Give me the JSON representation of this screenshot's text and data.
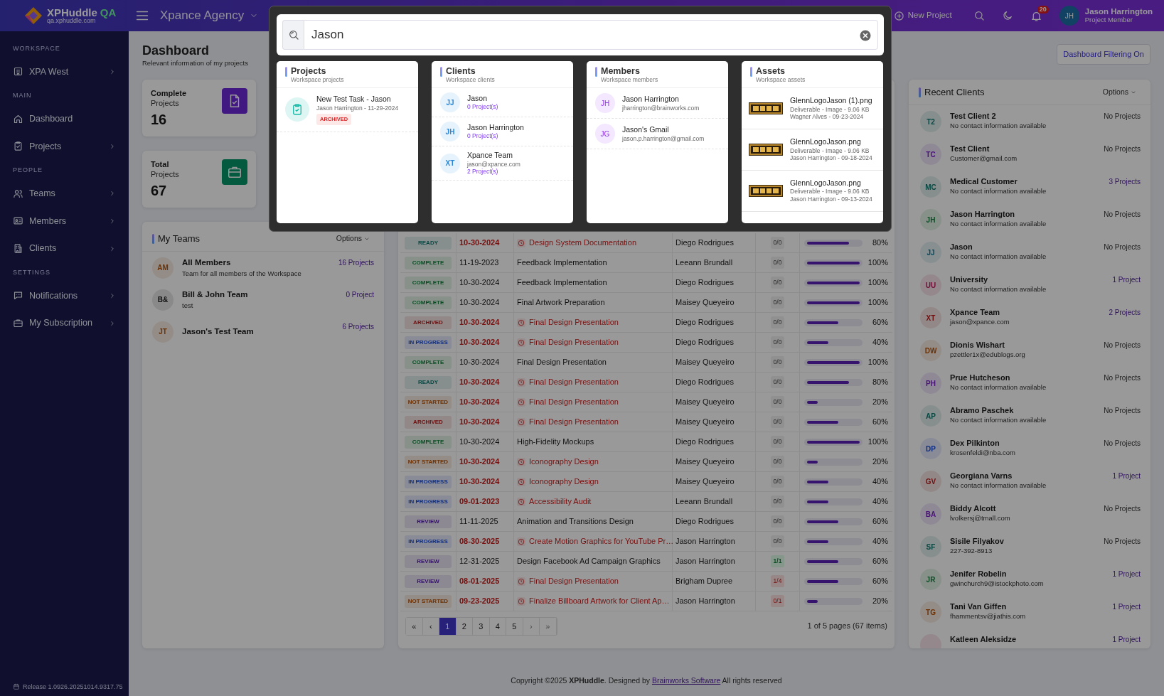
{
  "topbar": {
    "brand": "XPHuddle",
    "brand_tag": "QA",
    "brand_url": "qa.xphuddle.com",
    "workspace": "Xpance Agency",
    "new_project": "New Project",
    "notifications_count": "20",
    "user": {
      "initials": "JH",
      "name": "Jason Harrington",
      "role": "Project Member"
    }
  },
  "sidebar": {
    "sections": [
      {
        "title": "WORKSPACE",
        "items": [
          {
            "label": "XPA West",
            "has_submenu": true
          }
        ]
      },
      {
        "title": "MAIN",
        "items": [
          {
            "label": "Dashboard",
            "has_submenu": false
          },
          {
            "label": "Projects",
            "has_submenu": true
          }
        ]
      },
      {
        "title": "PEOPLE",
        "items": [
          {
            "label": "Teams",
            "has_submenu": true
          },
          {
            "label": "Members",
            "has_submenu": true
          },
          {
            "label": "Clients",
            "has_submenu": true
          }
        ]
      },
      {
        "title": "SETTINGS",
        "items": [
          {
            "label": "Notifications",
            "has_submenu": true
          },
          {
            "label": "My Subscription",
            "has_submenu": true
          }
        ]
      }
    ],
    "release": "Release 1.0926.20251014.9317.75"
  },
  "page": {
    "title": "Dashboard",
    "subtitle": "Relevant information of my projects",
    "filter_button": "Dashboard Filtering On"
  },
  "stats": [
    {
      "kind": "complete",
      "label": "Complete",
      "sublabel": "Projects",
      "value": "16"
    },
    {
      "kind": "total",
      "label": "Total",
      "sublabel": "Projects",
      "value": "67"
    }
  ],
  "my_teams": {
    "title": "My Teams",
    "options": "Options",
    "teams": [
      {
        "initials": "AM",
        "kind": "amber",
        "name": "All Members",
        "description": "Team for all members of the Workspace",
        "projects": "16 Projects"
      },
      {
        "initials": "B&",
        "kind": "neutral",
        "name": "Bill & John Team",
        "description": "test",
        "projects": "0 Project"
      },
      {
        "initials": "JT",
        "kind": "amber",
        "name": "Jason's Test Team",
        "projects": "6 Projects"
      }
    ]
  },
  "projects_table": {
    "rows": [
      {
        "status": "READY",
        "kind": "ready",
        "date": "10-30-2024",
        "overdue": true,
        "title": "Design System Documentation",
        "assignee": "Diego Rodrigues",
        "count": "0/0",
        "count_done": false,
        "count_behind": false,
        "level": 0.8,
        "percent": "80%"
      },
      {
        "status": "COMPLETE",
        "kind": "complete",
        "date": "11-19-2023",
        "overdue": false,
        "title": "Feedback Implementation",
        "assignee": "Leeann Brundall",
        "count": "0/0",
        "count_done": false,
        "count_behind": false,
        "level": 1,
        "percent": "100%"
      },
      {
        "status": "COMPLETE",
        "kind": "complete",
        "date": "10-30-2024",
        "overdue": false,
        "title": "Feedback Implementation",
        "assignee": "Diego Rodrigues",
        "count": "0/0",
        "count_done": false,
        "count_behind": false,
        "level": 1,
        "percent": "100%"
      },
      {
        "status": "COMPLETE",
        "kind": "complete",
        "date": "10-30-2024",
        "overdue": false,
        "title": "Final Artwork Preparation",
        "assignee": "Maisey Queyeiro",
        "count": "0/0",
        "count_done": false,
        "count_behind": false,
        "level": 1,
        "percent": "100%"
      },
      {
        "status": "ARCHIVED",
        "kind": "archived",
        "date": "10-30-2024",
        "overdue": true,
        "title": "Final Design Presentation",
        "assignee": "Diego Rodrigues",
        "count": "0/0",
        "count_done": false,
        "count_behind": false,
        "level": 0.6,
        "percent": "60%"
      },
      {
        "status": "IN PROGRESS",
        "kind": "progress",
        "date": "10-30-2024",
        "overdue": true,
        "title": "Final Design Presentation",
        "assignee": "Diego Rodrigues",
        "count": "0/0",
        "count_done": false,
        "count_behind": false,
        "level": 0.4,
        "percent": "40%"
      },
      {
        "status": "COMPLETE",
        "kind": "complete",
        "date": "10-30-2024",
        "overdue": false,
        "title": "Final Design Presentation",
        "assignee": "Maisey Queyeiro",
        "count": "0/0",
        "count_done": false,
        "count_behind": false,
        "level": 1,
        "percent": "100%"
      },
      {
        "status": "READY",
        "kind": "ready",
        "date": "10-30-2024",
        "overdue": true,
        "title": "Final Design Presentation",
        "assignee": "Diego Rodrigues",
        "count": "0/0",
        "count_done": false,
        "count_behind": false,
        "level": 0.8,
        "percent": "80%"
      },
      {
        "status": "NOT STARTED",
        "kind": "notstarted",
        "date": "10-30-2024",
        "overdue": true,
        "title": "Final Design Presentation",
        "assignee": "Maisey Queyeiro",
        "count": "0/0",
        "count_done": false,
        "count_behind": false,
        "level": 0.2,
        "percent": "20%"
      },
      {
        "status": "ARCHIVED",
        "kind": "archived",
        "date": "10-30-2024",
        "overdue": true,
        "title": "Final Design Presentation",
        "assignee": "Maisey Queyeiro",
        "count": "0/0",
        "count_done": false,
        "count_behind": false,
        "level": 0.6,
        "percent": "60%"
      },
      {
        "status": "COMPLETE",
        "kind": "complete",
        "date": "10-30-2024",
        "overdue": false,
        "title": "High-Fidelity Mockups",
        "assignee": "Diego Rodrigues",
        "count": "0/0",
        "count_done": false,
        "count_behind": false,
        "level": 1,
        "percent": "100%"
      },
      {
        "status": "NOT STARTED",
        "kind": "notstarted",
        "date": "10-30-2024",
        "overdue": true,
        "title": "Iconography Design",
        "assignee": "Maisey Queyeiro",
        "count": "0/0",
        "count_done": false,
        "count_behind": false,
        "level": 0.2,
        "percent": "20%"
      },
      {
        "status": "IN PROGRESS",
        "kind": "progress",
        "date": "10-30-2024",
        "overdue": true,
        "title": "Iconography Design",
        "assignee": "Maisey Queyeiro",
        "count": "0/0",
        "count_done": false,
        "count_behind": false,
        "level": 0.4,
        "percent": "40%"
      },
      {
        "status": "IN PROGRESS",
        "kind": "progress",
        "date": "09-01-2023",
        "overdue": true,
        "title": "Accessibility Audit",
        "assignee": "Leeann Brundall",
        "count": "0/0",
        "count_done": false,
        "count_behind": false,
        "level": 0.4,
        "percent": "40%"
      },
      {
        "status": "REVIEW",
        "kind": "review",
        "date": "11-11-2025",
        "overdue": false,
        "title": "Animation and Transitions Design",
        "assignee": "Diego Rodrigues",
        "count": "0/0",
        "count_done": false,
        "count_behind": false,
        "level": 0.6,
        "percent": "60%"
      },
      {
        "status": "IN PROGRESS",
        "kind": "progress",
        "date": "08-30-2025",
        "overdue": true,
        "title": "Create Motion Graphics for YouTube Pr…",
        "assignee": "Jason Harrington",
        "count": "0/0",
        "count_done": false,
        "count_behind": false,
        "level": 0.4,
        "percent": "40%"
      },
      {
        "status": "REVIEW",
        "kind": "review",
        "date": "12-31-2025",
        "overdue": false,
        "title": "Design Facebook Ad Campaign Graphics",
        "assignee": "Jason Harrington",
        "count": "1/1",
        "count_done": true,
        "count_behind": false,
        "level": 0.6,
        "percent": "60%"
      },
      {
        "status": "REVIEW",
        "kind": "review",
        "date": "08-01-2025",
        "overdue": true,
        "title": "Final Design Presentation",
        "assignee": "Brigham Dupree",
        "count": "1/4",
        "count_done": false,
        "count_behind": true,
        "level": 0.6,
        "percent": "60%"
      },
      {
        "status": "NOT STARTED",
        "kind": "notstarted",
        "date": "09-23-2025",
        "overdue": true,
        "title": "Finalize Billboard Artwork for Client Ap…",
        "assignee": "Jason Harrington",
        "count": "0/1",
        "count_done": false,
        "count_behind": true,
        "level": 0.2,
        "percent": "20%"
      }
    ],
    "pagination": {
      "items": [
        {
          "label": "«",
          "selected": false,
          "disabled": false
        },
        {
          "label": "‹",
          "selected": false,
          "disabled": false
        },
        {
          "label": "1",
          "selected": true,
          "disabled": false
        },
        {
          "label": "2",
          "selected": false,
          "disabled": false
        },
        {
          "label": "3",
          "selected": false,
          "disabled": false
        },
        {
          "label": "4",
          "selected": false,
          "disabled": false
        },
        {
          "label": "5",
          "selected": false,
          "disabled": false
        },
        {
          "label": "›",
          "selected": false,
          "disabled": true
        },
        {
          "label": "»",
          "selected": false,
          "disabled": true
        }
      ],
      "summary": "1 of 5 pages (67 items)"
    }
  },
  "recent_clients": {
    "title": "Recent Clients",
    "options": "Options",
    "clients": [
      {
        "initials": "T2",
        "kind": "teal",
        "name": "Test Client 2",
        "contact": "No contact information available",
        "projects": "No Projects",
        "has_projects": false
      },
      {
        "initials": "TC",
        "kind": "purple",
        "name": "Test Client",
        "contact": "Customer@gmail.com",
        "projects": "No Projects",
        "has_projects": false
      },
      {
        "initials": "MC",
        "kind": "teal",
        "name": "Medical Customer",
        "contact": "No contact information available",
        "projects": "3 Projects",
        "has_projects": true
      },
      {
        "initials": "JH",
        "kind": "green",
        "name": "Jason Harrington",
        "contact": "No contact information available",
        "projects": "No Projects",
        "has_projects": false
      },
      {
        "initials": "JJ",
        "kind": "cyan",
        "name": "Jason",
        "contact": "No contact information available",
        "projects": "No Projects",
        "has_projects": false
      },
      {
        "initials": "UU",
        "kind": "pink",
        "name": "University",
        "contact": "No contact information available",
        "projects": "1 Project",
        "has_projects": true
      },
      {
        "initials": "XT",
        "kind": "red",
        "name": "Xpance Team",
        "contact": "jason@xpance.com",
        "projects": "2 Projects",
        "has_projects": true
      },
      {
        "initials": "DW",
        "kind": "amber",
        "name": "Dionis Wishart",
        "contact": "pzettler1x@edublogs.org",
        "projects": "No Projects",
        "has_projects": false
      },
      {
        "initials": "PH",
        "kind": "purple",
        "name": "Prue Hutcheson",
        "contact": "No contact information available",
        "projects": "No Projects",
        "has_projects": false
      },
      {
        "initials": "AP",
        "kind": "teal",
        "name": "Abramo Paschek",
        "contact": "No contact information available",
        "projects": "No Projects",
        "has_projects": false
      },
      {
        "initials": "DP",
        "kind": "blue",
        "name": "Dex Pilkinton",
        "contact": "krosenfeldi@nba.com",
        "projects": "No Projects",
        "has_projects": false
      },
      {
        "initials": "GV",
        "kind": "red",
        "name": "Georgiana Varns",
        "contact": "No contact information available",
        "projects": "1 Project",
        "has_projects": true
      },
      {
        "initials": "BA",
        "kind": "purple",
        "name": "Biddy Alcott",
        "contact": "lvolkersj@tmall.com",
        "projects": "No Projects",
        "has_projects": false
      },
      {
        "initials": "SF",
        "kind": "teal",
        "name": "Sisile Filyakov",
        "contact": "227-392-8913",
        "projects": "No Projects",
        "has_projects": false
      },
      {
        "initials": "JR",
        "kind": "green",
        "name": "Jenifer Robelin",
        "contact": "gwinchurch9@istockphoto.com",
        "projects": "1 Project",
        "has_projects": true
      },
      {
        "initials": "TG",
        "kind": "amber",
        "name": "Tani Van Giffen",
        "contact": "fhammentsv@jiathis.com",
        "projects": "1 Project",
        "has_projects": true
      },
      {
        "kind": "pink",
        "name": "Katleen Aleksidze",
        "projects": "1 Project",
        "has_projects": true
      }
    ]
  },
  "footer": {
    "text": "Copyright ©2025 **XPHuddle**. Designed by",
    "link": "Brainworks Software",
    "suffix": "All rights reserved"
  },
  "search": {
    "value": "Jason",
    "groups": [
      {
        "kind": "projects",
        "title": "Projects",
        "subtitle": "Workspace projects",
        "items": [
          {
            "title": "New Test Task - Jason",
            "meta": "Jason Harrington - 11-29-2024",
            "status": "ARCHIVED",
            "color": "#dc2626"
          }
        ]
      },
      {
        "kind": "clients",
        "title": "Clients",
        "subtitle": "Workspace clients",
        "items": [
          {
            "initials": "JJ",
            "name": "Jason",
            "projects": "0 Project(s)"
          },
          {
            "initials": "JH",
            "name": "Jason Harrington",
            "projects": "0 Project(s)"
          },
          {
            "initials": "XT",
            "name": "Xpance Team",
            "email": "jason@xpance.com",
            "projects": "2 Project(s)"
          }
        ]
      },
      {
        "kind": "members",
        "title": "Members",
        "subtitle": "Workspace members",
        "items": [
          {
            "initials": "JH",
            "name": "Jason Harrington",
            "email": "jharrington@brainworks.com"
          },
          {
            "initials": "JG",
            "name": "Jason's Gmail",
            "email": "jason.p.harrington@gmail.com"
          }
        ]
      },
      {
        "kind": "assets",
        "title": "Assets",
        "subtitle": "Workspace assets",
        "items": [
          {
            "name": "GlennLogoJason (1).png",
            "meta": "Deliverable - Image - 9.06 KB",
            "owner": "Wagner Alves - 09-23-2024"
          },
          {
            "name": "GlennLogoJason.png",
            "meta": "Deliverable - Image - 9.06 KB",
            "owner": "Jason Harrington - 09-18-2024"
          },
          {
            "name": "GlennLogoJason.png",
            "meta": "Deliverable - Image - 9.06 KB",
            "owner": "Jason Harrington - 09-13-2024"
          }
        ]
      }
    ]
  }
}
